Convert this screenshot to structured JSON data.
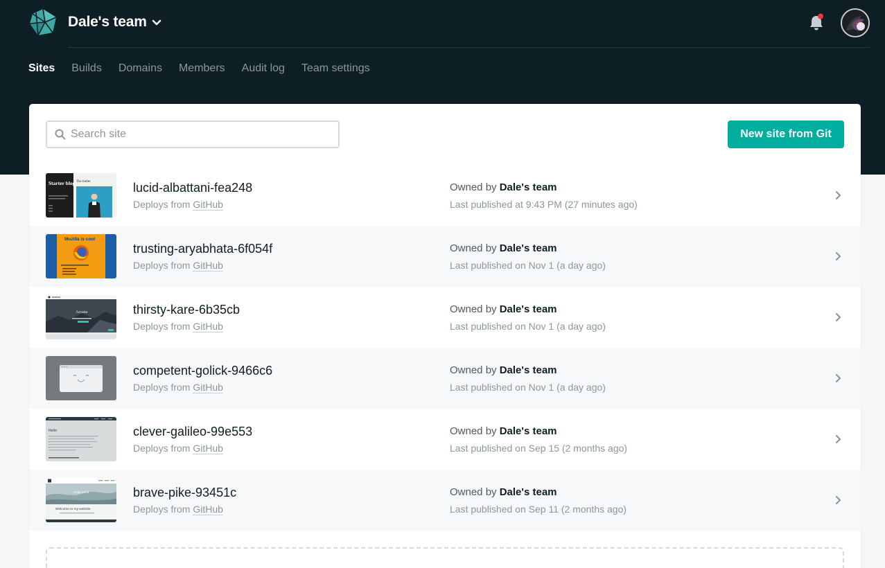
{
  "header": {
    "team_name": "Dale's team",
    "notification_dot_color": "#e5383b"
  },
  "nav": {
    "items": [
      {
        "label": "Sites",
        "active": true
      },
      {
        "label": "Builds"
      },
      {
        "label": "Domains"
      },
      {
        "label": "Members"
      },
      {
        "label": "Audit log"
      },
      {
        "label": "Team settings"
      }
    ]
  },
  "search": {
    "placeholder": "Search site",
    "value": ""
  },
  "actions": {
    "new_site_label": "New site from Git"
  },
  "sites": [
    {
      "name": "lucid-albattani-fea248",
      "deploys_prefix": "Deploys from",
      "deploys_source": "GitHub",
      "owned_prefix": "Owned by",
      "owner": "Dale's team",
      "published": "Last published at 9:43 PM (27 minutes ago)"
    },
    {
      "name": "trusting-aryabhata-6f054f",
      "deploys_prefix": "Deploys from",
      "deploys_source": "GitHub",
      "owned_prefix": "Owned by",
      "owner": "Dale's team",
      "published": "Last published on Nov 1 (a day ago)"
    },
    {
      "name": "thirsty-kare-6b35cb",
      "deploys_prefix": "Deploys from",
      "deploys_source": "GitHub",
      "owned_prefix": "Owned by",
      "owner": "Dale's team",
      "published": "Last published on Nov 1 (a day ago)"
    },
    {
      "name": "competent-golick-9466c6",
      "deploys_prefix": "Deploys from",
      "deploys_source": "GitHub",
      "owned_prefix": "Owned by",
      "owner": "Dale's team",
      "published": "Last published on Nov 1 (a day ago)"
    },
    {
      "name": "clever-galileo-99e553",
      "deploys_prefix": "Deploys from",
      "deploys_source": "GitHub",
      "owned_prefix": "Owned by",
      "owner": "Dale's team",
      "published": "Last published on Sep 15 (2 months ago)"
    },
    {
      "name": "brave-pike-93451c",
      "deploys_prefix": "Deploys from",
      "deploys_source": "GitHub",
      "owned_prefix": "Owned by",
      "owner": "Dale's team",
      "published": "Last published on Sep 11 (2 months ago)"
    }
  ],
  "thumbnails": {
    "t1": {
      "title": "Starter blog",
      "caption": "The butler"
    },
    "t2": {
      "title": "Mozilla is cool"
    },
    "t3": {
      "title": "Arcana"
    },
    "t5": {
      "title": "Hello"
    },
    "t6": {
      "title": "Hello world",
      "subtitle": "Welcome to my website"
    }
  },
  "colors": {
    "header_bg": "#0e1e25",
    "accent": "#00ad9f",
    "muted_text": "#8b979c",
    "row_alt_bg": "#f7f8f9"
  },
  "icons": {
    "logo": "netlify-logo-icon",
    "caret": "chevron-down-icon",
    "bell": "bell-icon",
    "search": "search-icon",
    "row_arrow": "chevron-right-icon"
  }
}
